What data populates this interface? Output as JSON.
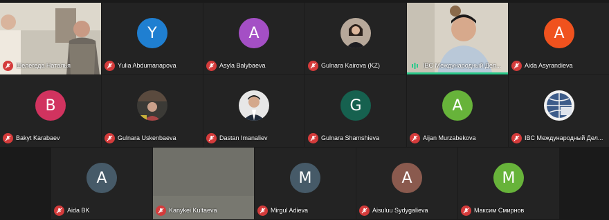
{
  "row1": [
    {
      "name": "Шелегеда Наталья",
      "kind": "video"
    },
    {
      "name": "Yulia Abdumanapova",
      "initial": "Y",
      "color": "#1f7fd1"
    },
    {
      "name": "Asyla Balybaeva",
      "initial": "A",
      "color": "#a44fc5"
    },
    {
      "name": "Gulnara Kairova (KZ)",
      "kind": "photo"
    },
    {
      "name": "IBC Международный Дел...",
      "kind": "video"
    },
    {
      "name": "Aida Asyrandieva",
      "initial": "A",
      "color": "#f0521e"
    }
  ],
  "row2": [
    {
      "name": "Bakyt Karabaev",
      "initial": "B",
      "color": "#d1335f"
    },
    {
      "name": "Gulnara Uskenbaeva",
      "kind": "photo"
    },
    {
      "name": "Dastan Imanaliev",
      "kind": "photo"
    },
    {
      "name": "Gulnara Shamshieva",
      "initial": "G",
      "color": "#16614f"
    },
    {
      "name": "Aijan Murzabekova",
      "initial": "A",
      "color": "#67b33a"
    },
    {
      "name": "IBC Международный Дел...",
      "kind": "photo"
    }
  ],
  "row3": [
    {
      "name": "Aida BK",
      "initial": "A",
      "color": "#465a68"
    },
    {
      "name": "Kanykei Kultaeva",
      "kind": "blank"
    },
    {
      "name": "Mirgul Adieva",
      "initial": "M",
      "color": "#465a68"
    },
    {
      "name": "Aisuluu Sydygalieva",
      "initial": "A",
      "color": "#8a5a4e"
    },
    {
      "name": "Максим Смирнов",
      "initial": "M",
      "color": "#67b33a"
    }
  ],
  "icons": {
    "muted": "mic-muted-icon",
    "speaking": "audio-level-icon"
  }
}
